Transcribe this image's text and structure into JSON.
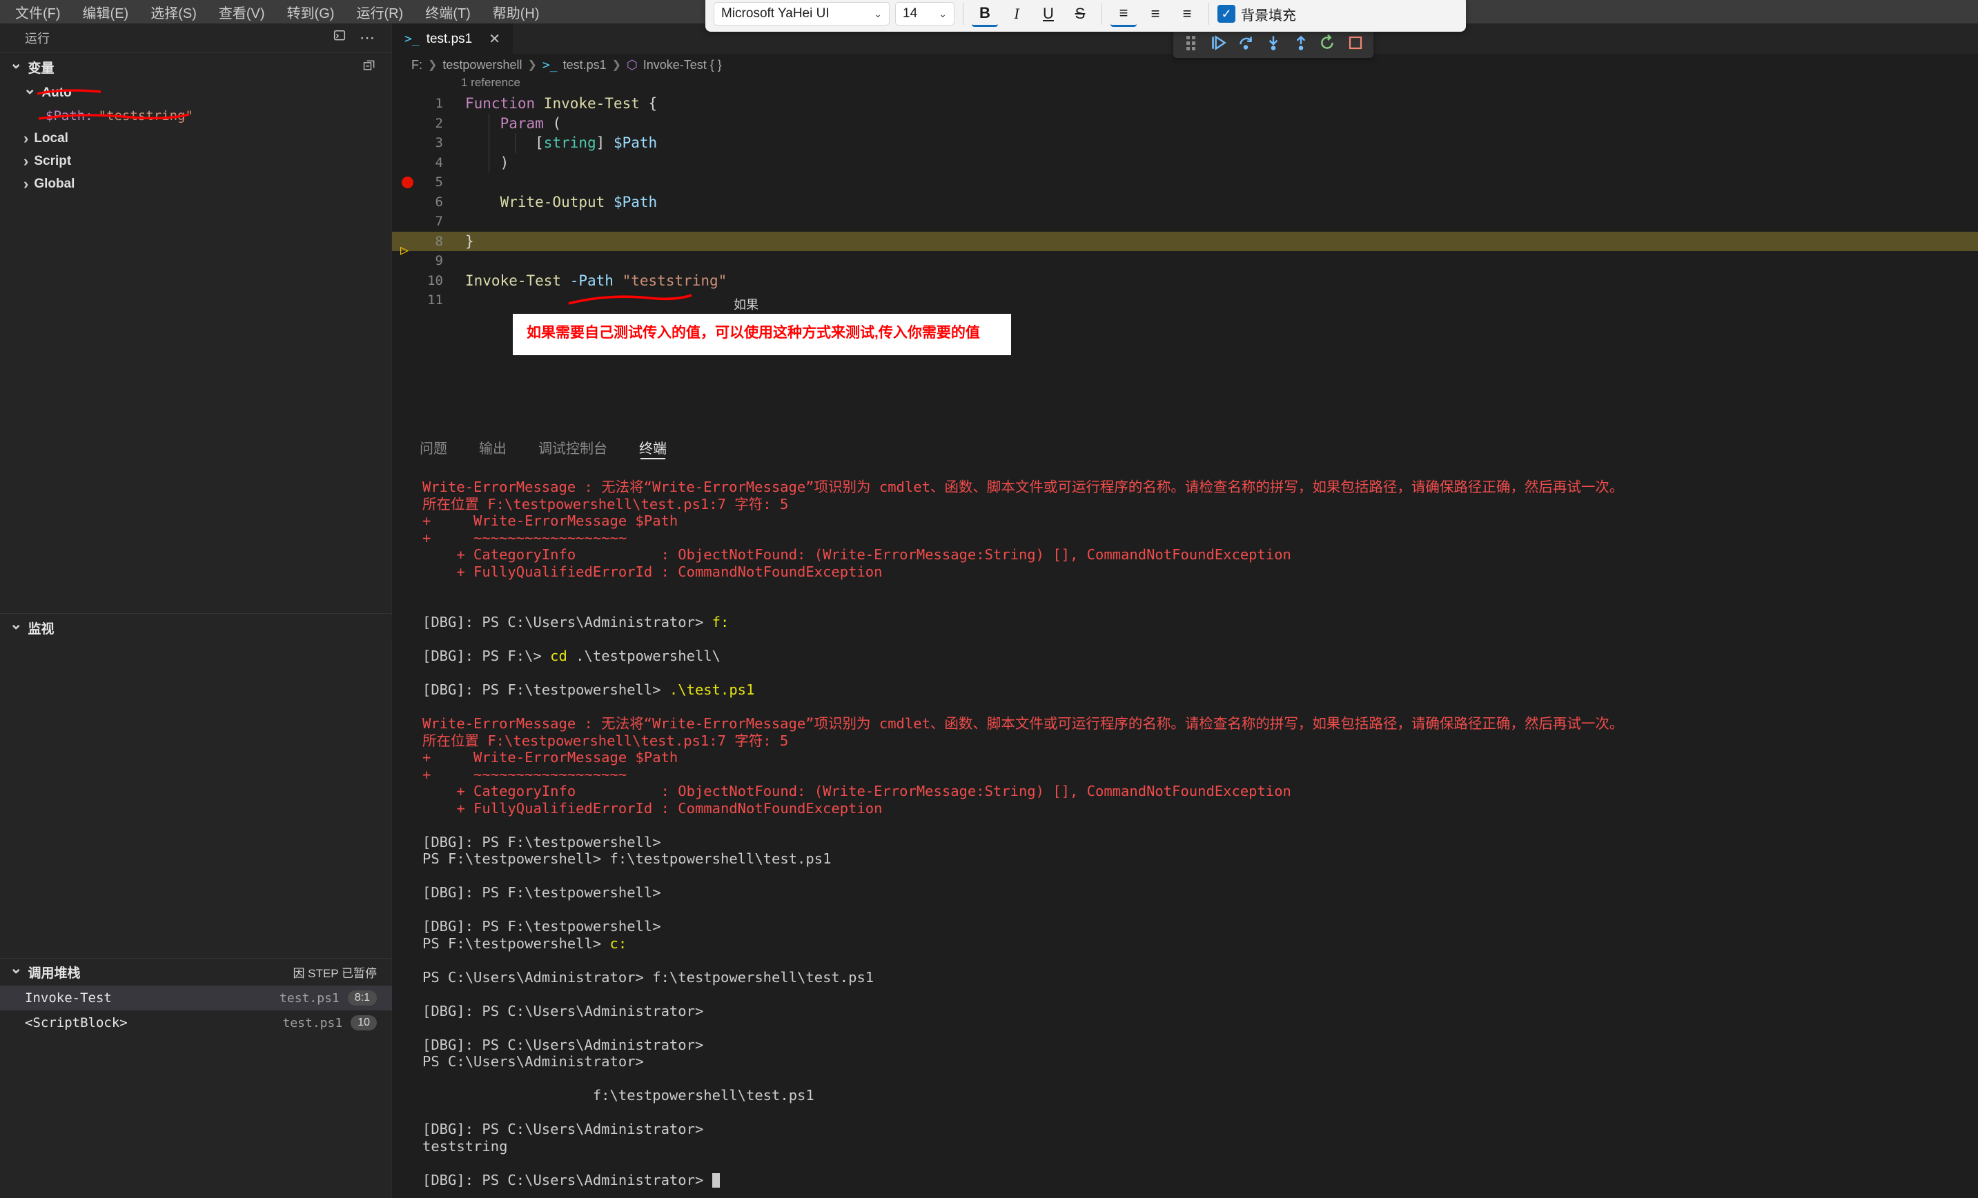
{
  "menubar": {
    "items": [
      {
        "label": "文件(F)"
      },
      {
        "label": "编辑(E)"
      },
      {
        "label": "选择(S)"
      },
      {
        "label": "查看(V)"
      },
      {
        "label": "转到(G)"
      },
      {
        "label": "运行(R)"
      },
      {
        "label": "终端(T)"
      },
      {
        "label": "帮助(H)"
      }
    ]
  },
  "format_toolbar": {
    "font_family_value": "Microsoft YaHei UI",
    "font_size_value": "14",
    "bold_label": "B",
    "italic_label": "I",
    "underline_label": "U",
    "strikethrough_label": "S",
    "align_left_label": "≡",
    "align_center_label": "≡",
    "align_right_label": "≡",
    "checkbox_glyph": "✓",
    "fill_label": "背景填充",
    "accent_color": "#0f6cbd"
  },
  "debug_toolbar": {
    "buttons": [
      {
        "name": "drag-handle",
        "title": "拖动"
      },
      {
        "name": "continue",
        "title": "继续"
      },
      {
        "name": "step-over",
        "title": "单步跳过"
      },
      {
        "name": "step-into",
        "title": "单步调试"
      },
      {
        "name": "step-out",
        "title": "单步跳出"
      },
      {
        "name": "restart",
        "title": "重启"
      },
      {
        "name": "stop",
        "title": "停止"
      }
    ]
  },
  "sidebar": {
    "title": "运行",
    "variables": {
      "title": "变量",
      "scopes": [
        {
          "label": "Auto",
          "expanded": true
        },
        {
          "label": "Local",
          "expanded": false
        },
        {
          "label": "Script",
          "expanded": false
        },
        {
          "label": "Global",
          "expanded": false
        }
      ],
      "auto_items": [
        {
          "name": "$Path:",
          "value": "\"teststring\""
        }
      ]
    },
    "watch": {
      "title": "监视"
    },
    "callstack": {
      "title": "调用堆栈",
      "paused_reason": "因 STEP 已暂停",
      "frames": [
        {
          "fn": "Invoke-Test",
          "file": "test.ps1",
          "pos": "8:1",
          "selected": true
        },
        {
          "fn": "<ScriptBlock>",
          "file": "test.ps1",
          "pos": "10",
          "selected": false
        }
      ]
    }
  },
  "editor": {
    "tab": {
      "label": "test.ps1",
      "icon": ">_",
      "close": "✕"
    },
    "breadcrumb": [
      "F:",
      "testpowershell",
      "test.ps1",
      "Invoke-Test { }"
    ],
    "codelens": "1 reference",
    "current_line": 8,
    "breakpoint_line": 5,
    "lines": [
      {
        "n": "1",
        "tokens": [
          {
            "t": "Function ",
            "c": "kw"
          },
          {
            "t": "Invoke-Test",
            "c": "fn"
          },
          {
            "t": " {",
            "c": "punc"
          }
        ]
      },
      {
        "n": "2",
        "tokens": [
          {
            "t": "    ",
            "c": "punc"
          },
          {
            "t": "Param",
            "c": "kw"
          },
          {
            "t": " (",
            "c": "punc"
          }
        ]
      },
      {
        "n": "3",
        "tokens": [
          {
            "t": "        [",
            "c": "punc"
          },
          {
            "t": "string",
            "c": "typ"
          },
          {
            "t": "] ",
            "c": "punc"
          },
          {
            "t": "$Path",
            "c": "var"
          }
        ]
      },
      {
        "n": "4",
        "tokens": [
          {
            "t": "    )",
            "c": "punc"
          }
        ]
      },
      {
        "n": "5",
        "tokens": []
      },
      {
        "n": "6",
        "tokens": [
          {
            "t": "    ",
            "c": "punc"
          },
          {
            "t": "Write-Output",
            "c": "cmd"
          },
          {
            "t": " ",
            "c": "punc"
          },
          {
            "t": "$Path",
            "c": "var"
          }
        ]
      },
      {
        "n": "7",
        "tokens": []
      },
      {
        "n": "8",
        "tokens": [
          {
            "t": "}",
            "c": "punc"
          }
        ]
      },
      {
        "n": "9",
        "tokens": []
      },
      {
        "n": "10",
        "tokens": [
          {
            "t": "Invoke-Test",
            "c": "cmd"
          },
          {
            "t": " ",
            "c": "punc"
          },
          {
            "t": "-Path",
            "c": "param"
          },
          {
            "t": " ",
            "c": "punc"
          },
          {
            "t": "\"teststring\"",
            "c": "str"
          }
        ]
      },
      {
        "n": "11",
        "tokens": []
      }
    ]
  },
  "annotation": {
    "note_text": "如果需要自己测试传入的值，可以使用这种方式来测试,传入你需要的值",
    "ghost_text": "如果",
    "ink_color": "#ff0000"
  },
  "panel": {
    "tabs": [
      {
        "label": "问题",
        "active": false
      },
      {
        "label": "输出",
        "active": false
      },
      {
        "label": "调试控制台",
        "active": false
      },
      {
        "label": "终端",
        "active": true
      }
    ],
    "terminal_lines": [
      {
        "text": "Write-ErrorMessage : 无法将“Write-ErrorMessage”项识别为 cmdlet、函数、脚本文件或可运行程序的名称。请检查名称的拼写，如果包括路径，请确保路径正确，然后再试一次。",
        "color": "err"
      },
      {
        "text": "所在位置 F:\\testpowershell\\test.ps1:7 字符: 5",
        "color": "err"
      },
      {
        "text": "+     Write-ErrorMessage $Path",
        "color": "err"
      },
      {
        "text": "+     ~~~~~~~~~~~~~~~~~~",
        "color": "err"
      },
      {
        "text": "    + CategoryInfo          : ObjectNotFound: (Write-ErrorMessage:String) [], CommandNotFoundException",
        "color": "err"
      },
      {
        "text": "    + FullyQualifiedErrorId : CommandNotFoundException",
        "color": "err"
      },
      {
        "text": "",
        "color": "blank"
      },
      {
        "text": "",
        "color": "blank"
      },
      {
        "text": "[DBG]: PS C:\\Users\\Administrator> ",
        "color": "white",
        "cmd": "f:"
      },
      {
        "text": "",
        "color": "blank"
      },
      {
        "text": "[DBG]: PS F:\\> ",
        "color": "white",
        "cmd": "cd",
        "rest": " .\\testpowershell\\"
      },
      {
        "text": "",
        "color": "blank"
      },
      {
        "text": "[DBG]: PS F:\\testpowershell> ",
        "color": "white",
        "cmd": ".\\test.ps1"
      },
      {
        "text": "",
        "color": "blank"
      },
      {
        "text": "Write-ErrorMessage : 无法将“Write-ErrorMessage”项识别为 cmdlet、函数、脚本文件或可运行程序的名称。请检查名称的拼写，如果包括路径，请确保路径正确，然后再试一次。",
        "color": "err"
      },
      {
        "text": "所在位置 F:\\testpowershell\\test.ps1:7 字符: 5",
        "color": "err"
      },
      {
        "text": "+     Write-ErrorMessage $Path",
        "color": "err"
      },
      {
        "text": "+     ~~~~~~~~~~~~~~~~~~",
        "color": "err"
      },
      {
        "text": "    + CategoryInfo          : ObjectNotFound: (Write-ErrorMessage:String) [], CommandNotFoundException",
        "color": "err"
      },
      {
        "text": "    + FullyQualifiedErrorId : CommandNotFoundException",
        "color": "err"
      },
      {
        "text": "",
        "color": "blank"
      },
      {
        "text": "[DBG]: PS F:\\testpowershell>",
        "color": "white"
      },
      {
        "text": "PS F:\\testpowershell> f:\\testpowershell\\test.ps1",
        "color": "white"
      },
      {
        "text": "",
        "color": "blank"
      },
      {
        "text": "[DBG]: PS F:\\testpowershell>",
        "color": "white"
      },
      {
        "text": "",
        "color": "blank"
      },
      {
        "text": "[DBG]: PS F:\\testpowershell>",
        "color": "white"
      },
      {
        "text": "PS F:\\testpowershell> ",
        "color": "white",
        "cmd": "c:"
      },
      {
        "text": "",
        "color": "blank"
      },
      {
        "text": "PS C:\\Users\\Administrator> f:\\testpowershell\\test.ps1",
        "color": "white"
      },
      {
        "text": "",
        "color": "blank"
      },
      {
        "text": "[DBG]: PS C:\\Users\\Administrator>",
        "color": "white"
      },
      {
        "text": "",
        "color": "blank"
      },
      {
        "text": "[DBG]: PS C:\\Users\\Administrator>",
        "color": "white"
      },
      {
        "text": "PS C:\\Users\\Administrator>",
        "color": "white"
      },
      {
        "text": "",
        "color": "blank"
      },
      {
        "text": "                    f:\\testpowershell\\test.ps1",
        "color": "white"
      },
      {
        "text": "",
        "color": "blank"
      },
      {
        "text": "[DBG]: PS C:\\Users\\Administrator>",
        "color": "white"
      },
      {
        "text": "teststring",
        "color": "white"
      },
      {
        "text": "",
        "color": "blank"
      },
      {
        "text": "[DBG]: PS C:\\Users\\Administrator> ",
        "color": "white",
        "caret": true
      }
    ]
  }
}
